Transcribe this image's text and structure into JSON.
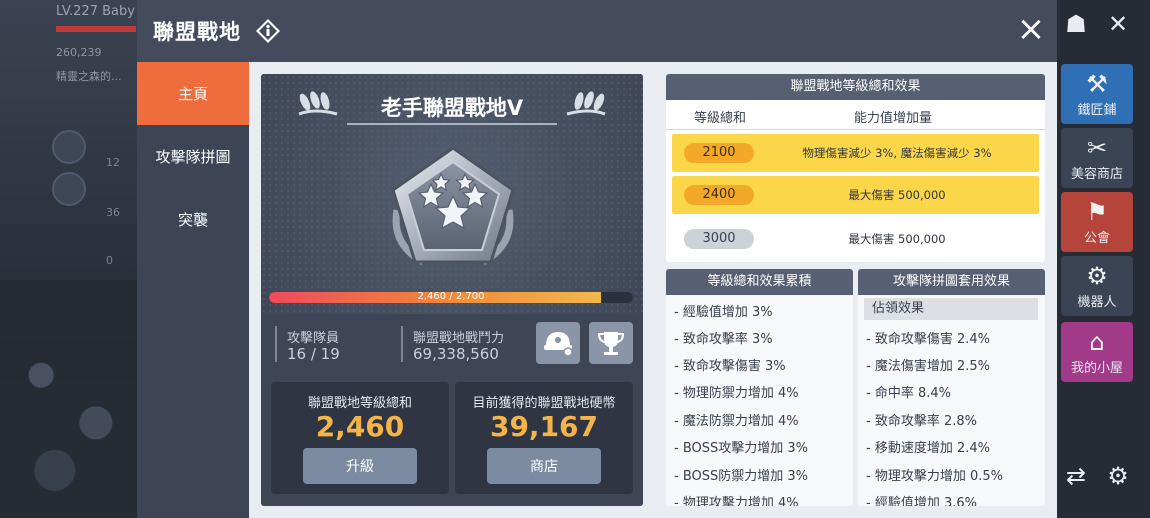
{
  "background": {
    "left_top_text": "LV.227 Baby",
    "left_rows": [
      "260,239",
      "精靈之森的..."
    ],
    "left_nums": [
      "12",
      "36",
      "0"
    ],
    "side_buttons": [
      {
        "label": "鐵匠鋪",
        "icon": "anvil-icon",
        "glyph": "⚒",
        "color": "#2f6fb6"
      },
      {
        "label": "美容商店",
        "icon": "comb-scissors-icon",
        "glyph": "✂",
        "color": "#3a4455"
      },
      {
        "label": "公會",
        "icon": "guild-banner-icon",
        "glyph": "⚑",
        "color": "#b5443b"
      },
      {
        "label": "機器人",
        "icon": "robot-icon",
        "glyph": "⚙",
        "color": "#3a4455"
      },
      {
        "label": "我的小屋",
        "icon": "house-mushroom-icon",
        "glyph": "⌂",
        "color": "#a23a8a"
      }
    ]
  },
  "modal": {
    "title": "聯盟戰地",
    "close_glyph": "×",
    "nav": [
      {
        "label": "主頁",
        "active": true
      },
      {
        "label": "攻擊隊拼圖",
        "active": false
      },
      {
        "label": "突襲",
        "active": false
      }
    ]
  },
  "league": {
    "title": "老手聯盟戰地V",
    "progress_text": "2,460 / 2,700",
    "progress_current": 2460,
    "progress_max": 2700,
    "members_label": "攻擊隊員",
    "members_value": "16 / 19",
    "power_label": "聯盟戰地戰鬥力",
    "power_value": "69,338,560",
    "level_card": {
      "label": "聯盟戰地等級總和",
      "value": "2,460",
      "button": "升級"
    },
    "coin_card": {
      "label": "目前獲得的聯盟戰地硬幣",
      "value": "39,167",
      "button": "商店"
    }
  },
  "level_table": {
    "title": "聯盟戰地等級總和效果",
    "col1": "等級總和",
    "col2": "能力值增加量",
    "rows": [
      {
        "level": "2100",
        "effect": "物理傷害減少 3%, 魔法傷害減少 3%",
        "state": "achieved"
      },
      {
        "level": "2400",
        "effect": "最大傷害 500,000",
        "state": "achieved"
      },
      {
        "level": "3000",
        "effect": "最大傷害 500,000",
        "state": "locked"
      }
    ]
  },
  "accum": {
    "title": "等級總和效果累積",
    "items": [
      "- 經驗值增加 3%",
      "- 致命攻擊率 3%",
      "- 致命攻擊傷害 3%",
      "- 物理防禦力增加 4%",
      "- 魔法防禦力增加 4%",
      "- BOSS攻擊力增加 3%",
      "- BOSS防禦力增加 3%",
      "- 物理攻擊力增加 4%"
    ]
  },
  "puzzle": {
    "title": "攻擊隊拼圖套用效果",
    "subhead": "佔領效果",
    "items": [
      "- 致命攻擊傷害 2.4%",
      "- 魔法傷害增加 2.5%",
      "- 命中率 8.4%",
      "- 致命攻擊率 2.8%",
      "- 移動速度增加 2.4%",
      "- 物理攻擊力增加 0.5%",
      "- 經驗值增加 3.6%"
    ]
  }
}
